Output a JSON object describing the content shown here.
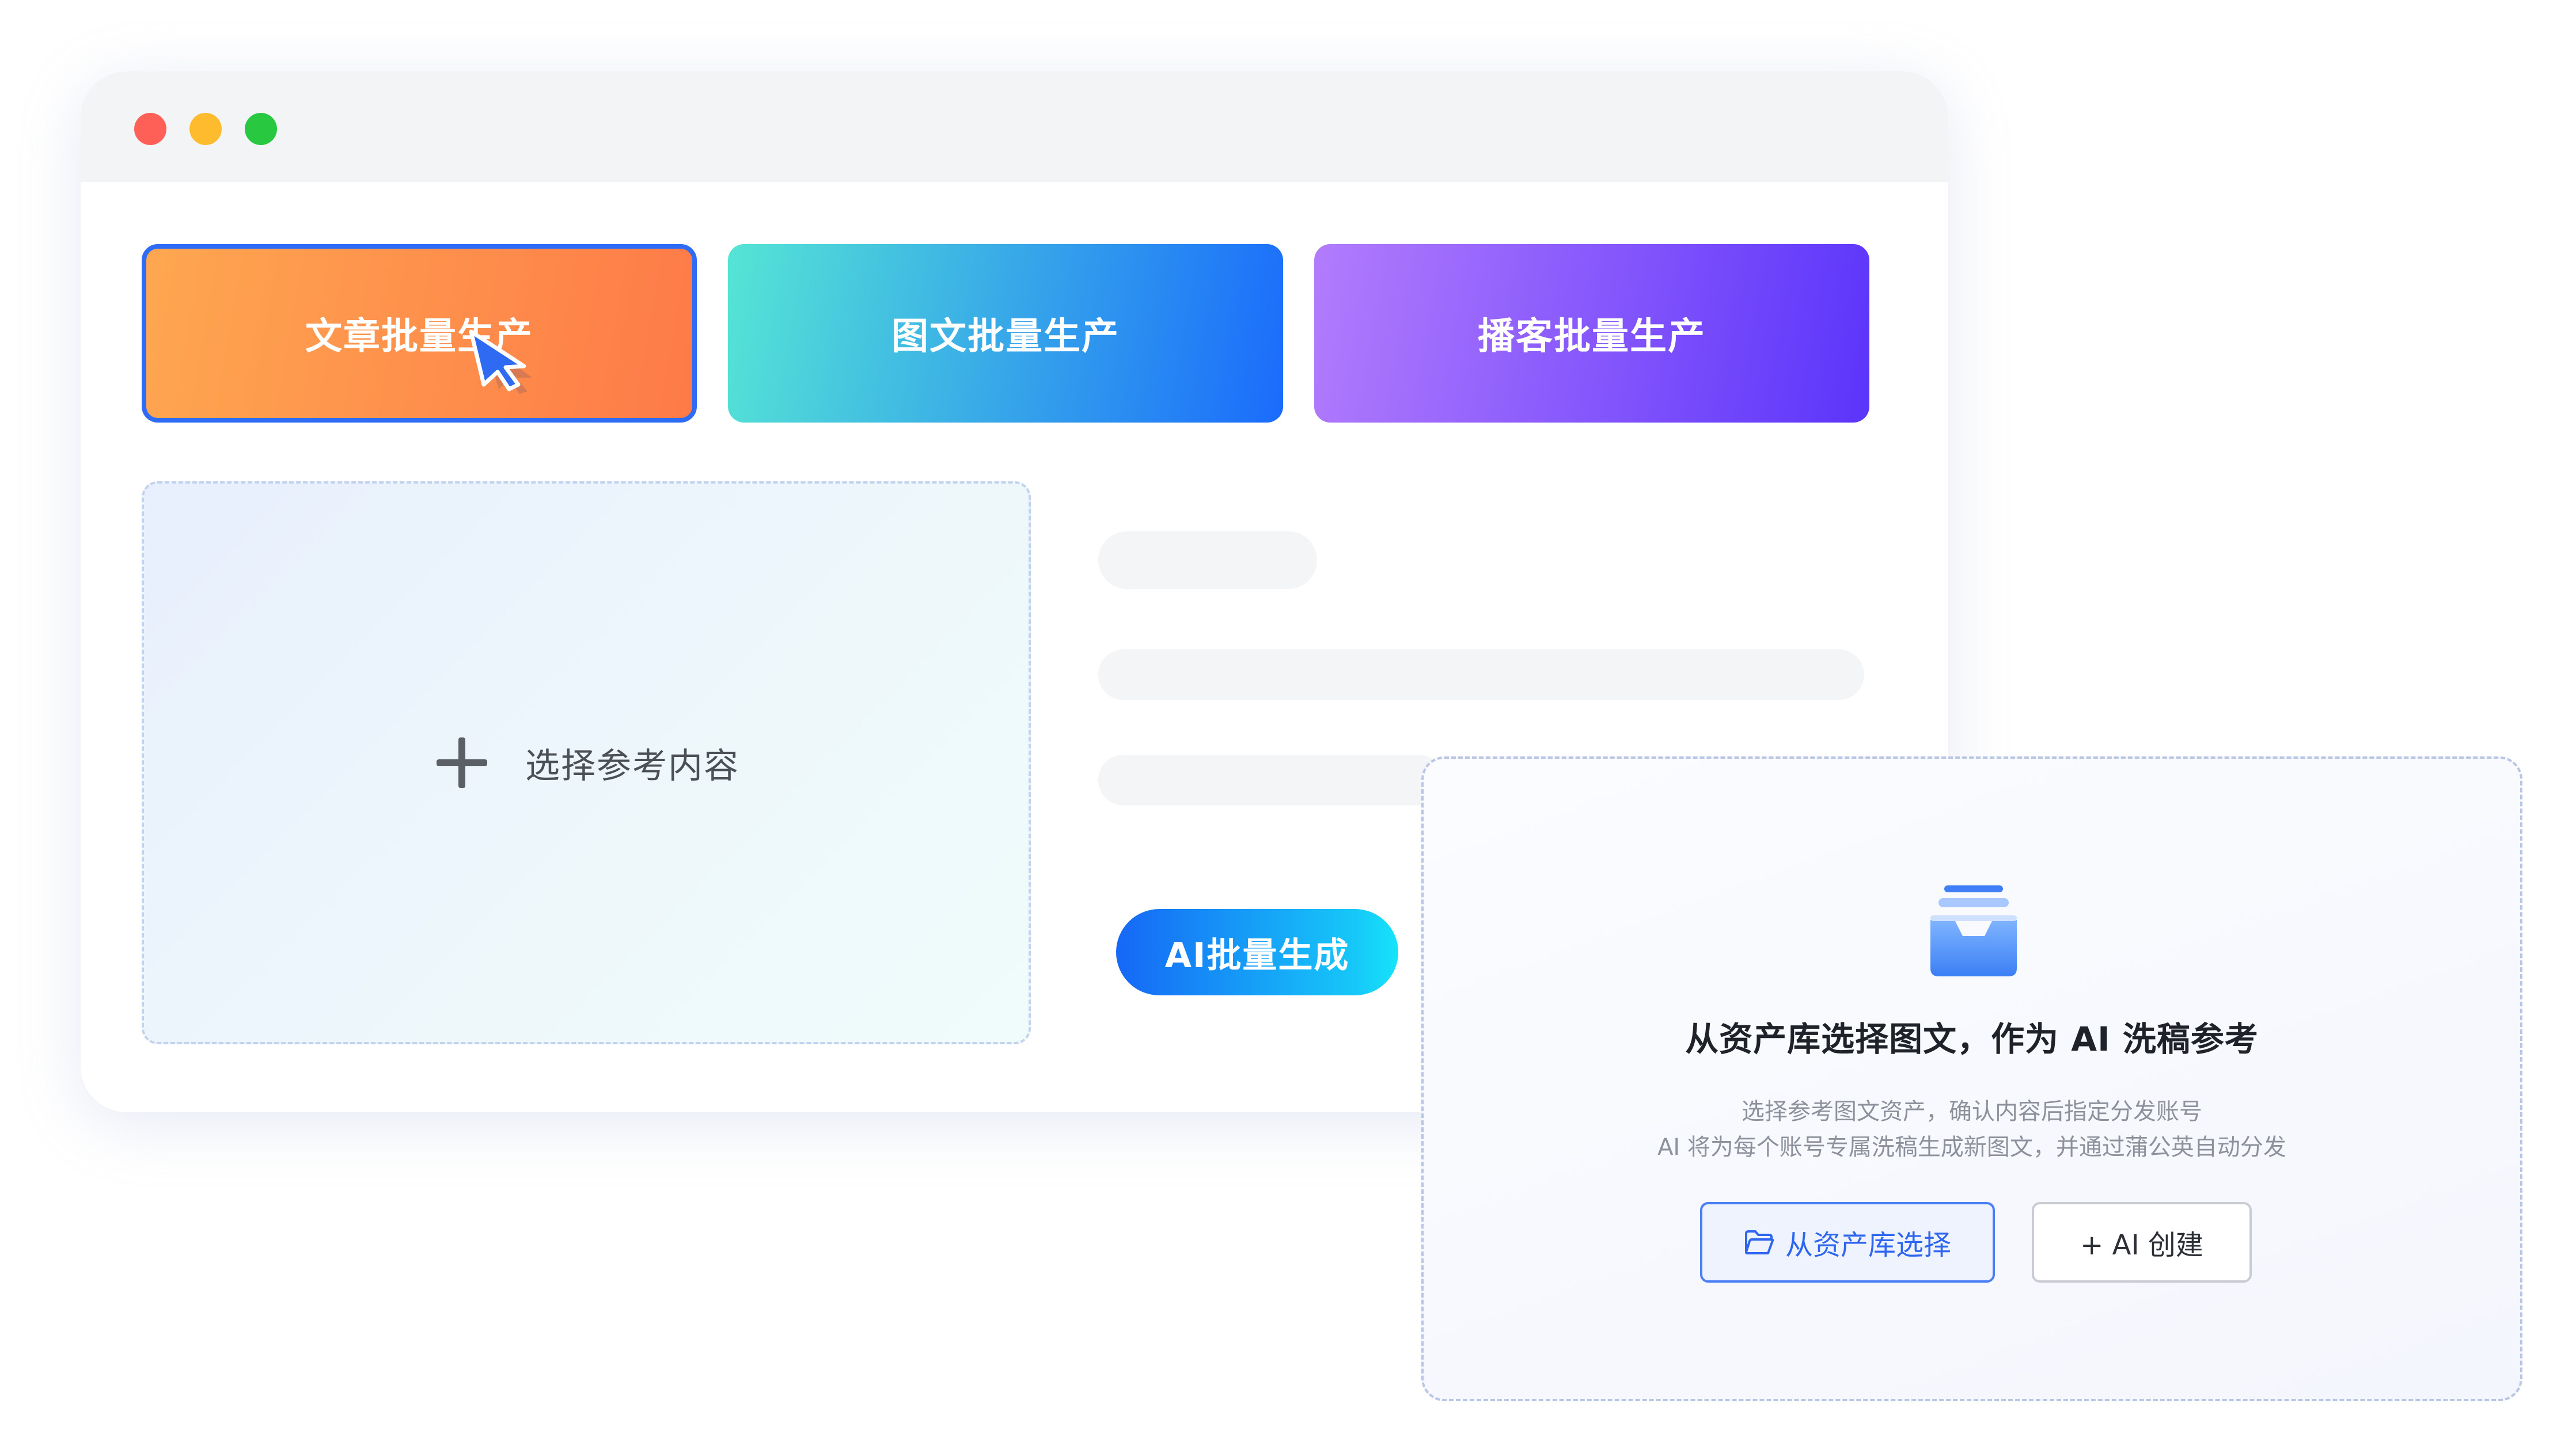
{
  "window": {
    "controls": [
      "close",
      "minimize",
      "maximize"
    ],
    "modes": [
      {
        "label": "文章批量生产",
        "selected": true
      },
      {
        "label": "图文批量生产",
        "selected": false
      },
      {
        "label": "播客批量生产",
        "selected": false
      }
    ],
    "reference": {
      "label": "选择参考内容",
      "icon": "plus-icon"
    },
    "generate_button": "AI批量生成"
  },
  "popup": {
    "icon": "inbox-tray-icon",
    "title": "从资产库选择图文，作为 AI 洗稿参考",
    "description": [
      "选择参考图文资产，确认内容后指定分发账号",
      "AI 将为每个账号专属洗稿生成新图文，并通过蒲公英自动分发"
    ],
    "library_button": "从资产库选择",
    "create_button": "+ AI 创建"
  },
  "colors": {
    "accent": "#2f6cf5",
    "article_gradient": [
      "#fea750",
      "#fe7a48"
    ],
    "graphic_gradient": [
      "#55e5d5",
      "#1a6bfc"
    ],
    "podcast_gradient": [
      "#b27cfc",
      "#5b34fb"
    ],
    "generate_gradient": [
      "#1667f6",
      "#16e4fa"
    ]
  }
}
